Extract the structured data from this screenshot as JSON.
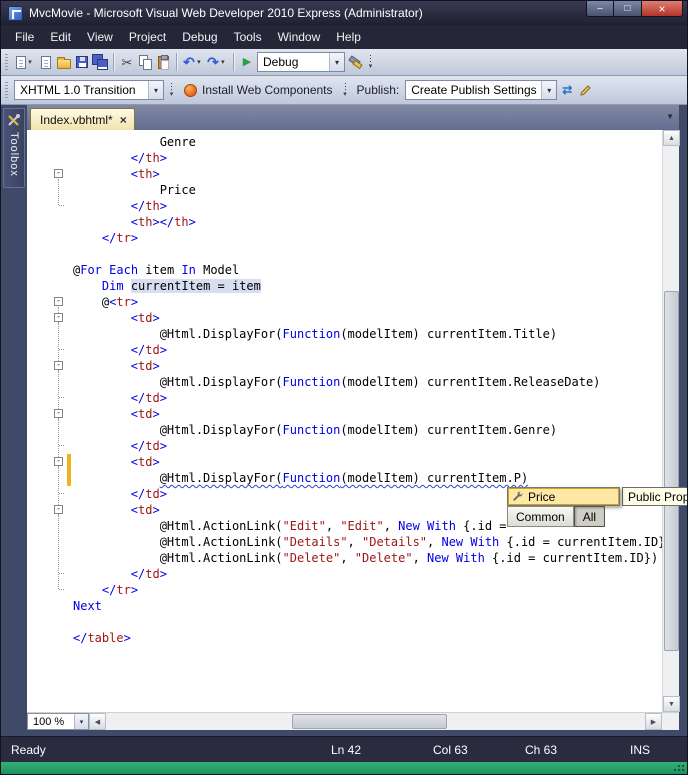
{
  "window": {
    "title": "MvcMovie - Microsoft Visual Web Developer 2010 Express (Administrator)"
  },
  "menu": {
    "items": [
      "File",
      "Edit",
      "View",
      "Project",
      "Debug",
      "Tools",
      "Window",
      "Help"
    ]
  },
  "toolbar1": {
    "debug_combo": "Debug"
  },
  "toolbar2": {
    "doctype_combo": "XHTML 1.0 Transition",
    "install_button": "Install Web Components",
    "publish_label": "Publish:",
    "publish_combo": "Create Publish Settings"
  },
  "tabs": [
    {
      "label": "Index.vbhtml*"
    }
  ],
  "toolbox": {
    "label": "Toolbox"
  },
  "icons": {
    "dropdown": "▾",
    "tab_close": "×",
    "minimize": "–",
    "maximize": "□",
    "close": "×",
    "scroll_up": "▲",
    "scroll_down": "▼",
    "scroll_left": "◀",
    "scroll_right": "▶",
    "play": "▶",
    "undo": "↶",
    "redo": "↷",
    "cut": "✂",
    "sync": "⇄",
    "doc_list": "▼",
    "fold": "-"
  },
  "editor": {
    "lines": [
      {
        "tokens": [
          [
            "p",
            "            Genre"
          ]
        ]
      },
      {
        "tokens": [
          [
            "p",
            "        "
          ],
          [
            "b",
            "</"
          ],
          [
            "m",
            "th"
          ],
          [
            "b",
            ">"
          ]
        ]
      },
      {
        "fold": true,
        "foldSpan": 2,
        "tokens": [
          [
            "p",
            "        "
          ],
          [
            "b",
            "<"
          ],
          [
            "m",
            "th"
          ],
          [
            "b",
            ">"
          ]
        ]
      },
      {
        "tokens": [
          [
            "p",
            "            Price"
          ]
        ]
      },
      {
        "tokens": [
          [
            "p",
            "        "
          ],
          [
            "b",
            "</"
          ],
          [
            "m",
            "th"
          ],
          [
            "b",
            ">"
          ]
        ]
      },
      {
        "tokens": [
          [
            "p",
            "        "
          ],
          [
            "b",
            "<"
          ],
          [
            "m",
            "th"
          ],
          [
            "b",
            "></"
          ],
          [
            "m",
            "th"
          ],
          [
            "b",
            ">"
          ]
        ]
      },
      {
        "tokens": [
          [
            "p",
            "    "
          ],
          [
            "b",
            "</"
          ],
          [
            "m",
            "tr"
          ],
          [
            "b",
            ">"
          ]
        ]
      },
      {
        "tokens": []
      },
      {
        "tokens": [
          [
            "p",
            "@"
          ],
          [
            "b",
            "For"
          ],
          [
            "p",
            " "
          ],
          [
            "b",
            "Each"
          ],
          [
            "p",
            " item "
          ],
          [
            "b",
            "In"
          ],
          [
            "p",
            " Model"
          ]
        ]
      },
      {
        "tokens": [
          [
            "p",
            "    "
          ],
          [
            "b",
            "Dim"
          ],
          [
            "p",
            " "
          ],
          [
            "hl",
            "currentItem = item"
          ]
        ]
      },
      {
        "fold": true,
        "foldSpan": 18,
        "tokens": [
          [
            "p",
            "    @"
          ],
          [
            "b",
            "<"
          ],
          [
            "m",
            "tr"
          ],
          [
            "b",
            ">"
          ]
        ]
      },
      {
        "fold": true,
        "foldSpan": 2,
        "tokens": [
          [
            "p",
            "        "
          ],
          [
            "b",
            "<"
          ],
          [
            "m",
            "td"
          ],
          [
            "b",
            ">"
          ]
        ]
      },
      {
        "tokens": [
          [
            "p",
            "            @Html.DisplayFor("
          ],
          [
            "b",
            "Function"
          ],
          [
            "p",
            "(modelItem) currentItem.Title)"
          ]
        ]
      },
      {
        "tokens": [
          [
            "p",
            "        "
          ],
          [
            "b",
            "</"
          ],
          [
            "m",
            "td"
          ],
          [
            "b",
            ">"
          ]
        ]
      },
      {
        "fold": true,
        "foldSpan": 2,
        "tokens": [
          [
            "p",
            "        "
          ],
          [
            "b",
            "<"
          ],
          [
            "m",
            "td"
          ],
          [
            "b",
            ">"
          ]
        ]
      },
      {
        "tokens": [
          [
            "p",
            "            @Html.DisplayFor("
          ],
          [
            "b",
            "Function"
          ],
          [
            "p",
            "(modelItem) currentItem.ReleaseDate)"
          ]
        ]
      },
      {
        "tokens": [
          [
            "p",
            "        "
          ],
          [
            "b",
            "</"
          ],
          [
            "m",
            "td"
          ],
          [
            "b",
            ">"
          ]
        ]
      },
      {
        "fold": true,
        "foldSpan": 2,
        "tokens": [
          [
            "p",
            "        "
          ],
          [
            "b",
            "<"
          ],
          [
            "m",
            "td"
          ],
          [
            "b",
            ">"
          ]
        ]
      },
      {
        "tokens": [
          [
            "p",
            "            @Html.DisplayFor("
          ],
          [
            "b",
            "Function"
          ],
          [
            "p",
            "(modelItem) currentItem.Genre)"
          ]
        ]
      },
      {
        "tokens": [
          [
            "p",
            "        "
          ],
          [
            "b",
            "</"
          ],
          [
            "m",
            "td"
          ],
          [
            "b",
            ">"
          ]
        ]
      },
      {
        "fold": true,
        "foldSpan": 2,
        "marker": true,
        "tokens": [
          [
            "p",
            "        "
          ],
          [
            "b",
            "<"
          ],
          [
            "m",
            "td"
          ],
          [
            "b",
            ">"
          ]
        ]
      },
      {
        "marker": true,
        "tokens": [
          [
            "p",
            "            "
          ],
          [
            "p sq",
            "@Html.DisplayFor("
          ],
          [
            "b sq",
            "Function"
          ],
          [
            "p sq",
            "(modelItem) currentItem.P)"
          ]
        ]
      },
      {
        "tokens": [
          [
            "p",
            "        "
          ],
          [
            "b",
            "</"
          ],
          [
            "m",
            "td"
          ],
          [
            "b",
            ">"
          ]
        ]
      },
      {
        "fold": true,
        "foldSpan": 4,
        "tokens": [
          [
            "p",
            "        "
          ],
          [
            "b",
            "<"
          ],
          [
            "m",
            "td"
          ],
          [
            "b",
            ">"
          ]
        ]
      },
      {
        "tokens": [
          [
            "p",
            "            @Html.ActionLink("
          ],
          [
            "m",
            "\"Edit\""
          ],
          [
            "p",
            ", "
          ],
          [
            "m",
            "\"Edit\""
          ],
          [
            "p",
            ", "
          ],
          [
            "b",
            "New With"
          ],
          [
            "p",
            " {.id = "
          ]
        ]
      },
      {
        "tokens": [
          [
            "p",
            "            @Html.ActionLink("
          ],
          [
            "m",
            "\"Details\""
          ],
          [
            "p",
            ", "
          ],
          [
            "m",
            "\"Details\""
          ],
          [
            "p",
            ", "
          ],
          [
            "b",
            "New With"
          ],
          [
            "p",
            " {.id = currentItem.ID})"
          ]
        ]
      },
      {
        "tokens": [
          [
            "p",
            "            @Html.ActionLink("
          ],
          [
            "m",
            "\"Delete\""
          ],
          [
            "p",
            ", "
          ],
          [
            "m",
            "\"Delete\""
          ],
          [
            "p",
            ", "
          ],
          [
            "b",
            "New With"
          ],
          [
            "p",
            " {.id = currentItem.ID})"
          ]
        ]
      },
      {
        "tokens": [
          [
            "p",
            "        "
          ],
          [
            "b",
            "</"
          ],
          [
            "m",
            "td"
          ],
          [
            "b",
            ">"
          ]
        ]
      },
      {
        "tokens": [
          [
            "p",
            "    "
          ],
          [
            "b",
            "</"
          ],
          [
            "m",
            "tr"
          ],
          [
            "b",
            ">"
          ]
        ]
      },
      {
        "tokens": [
          [
            "b",
            "Next"
          ]
        ]
      },
      {
        "tokens": []
      },
      {
        "tokens": [
          [
            "b",
            "</"
          ],
          [
            "m",
            "table"
          ],
          [
            "b",
            ">"
          ]
        ]
      }
    ]
  },
  "intellisense": {
    "selected_item": "Price",
    "tabs": [
      "Common",
      "All"
    ],
    "active_tab": "All",
    "tooltip": "Public Prop"
  },
  "zoom": "100 %",
  "status": {
    "ready": "Ready",
    "ln": "Ln 42",
    "col": "Col 63",
    "ch": "Ch 63",
    "ins": "INS"
  },
  "colors": {
    "accent_tab": "#F5E9B4",
    "error_squiggle": "#2B48C8",
    "change_marker": "#EDB41E",
    "keyword": "#0000E6",
    "tag": "#A31515"
  }
}
